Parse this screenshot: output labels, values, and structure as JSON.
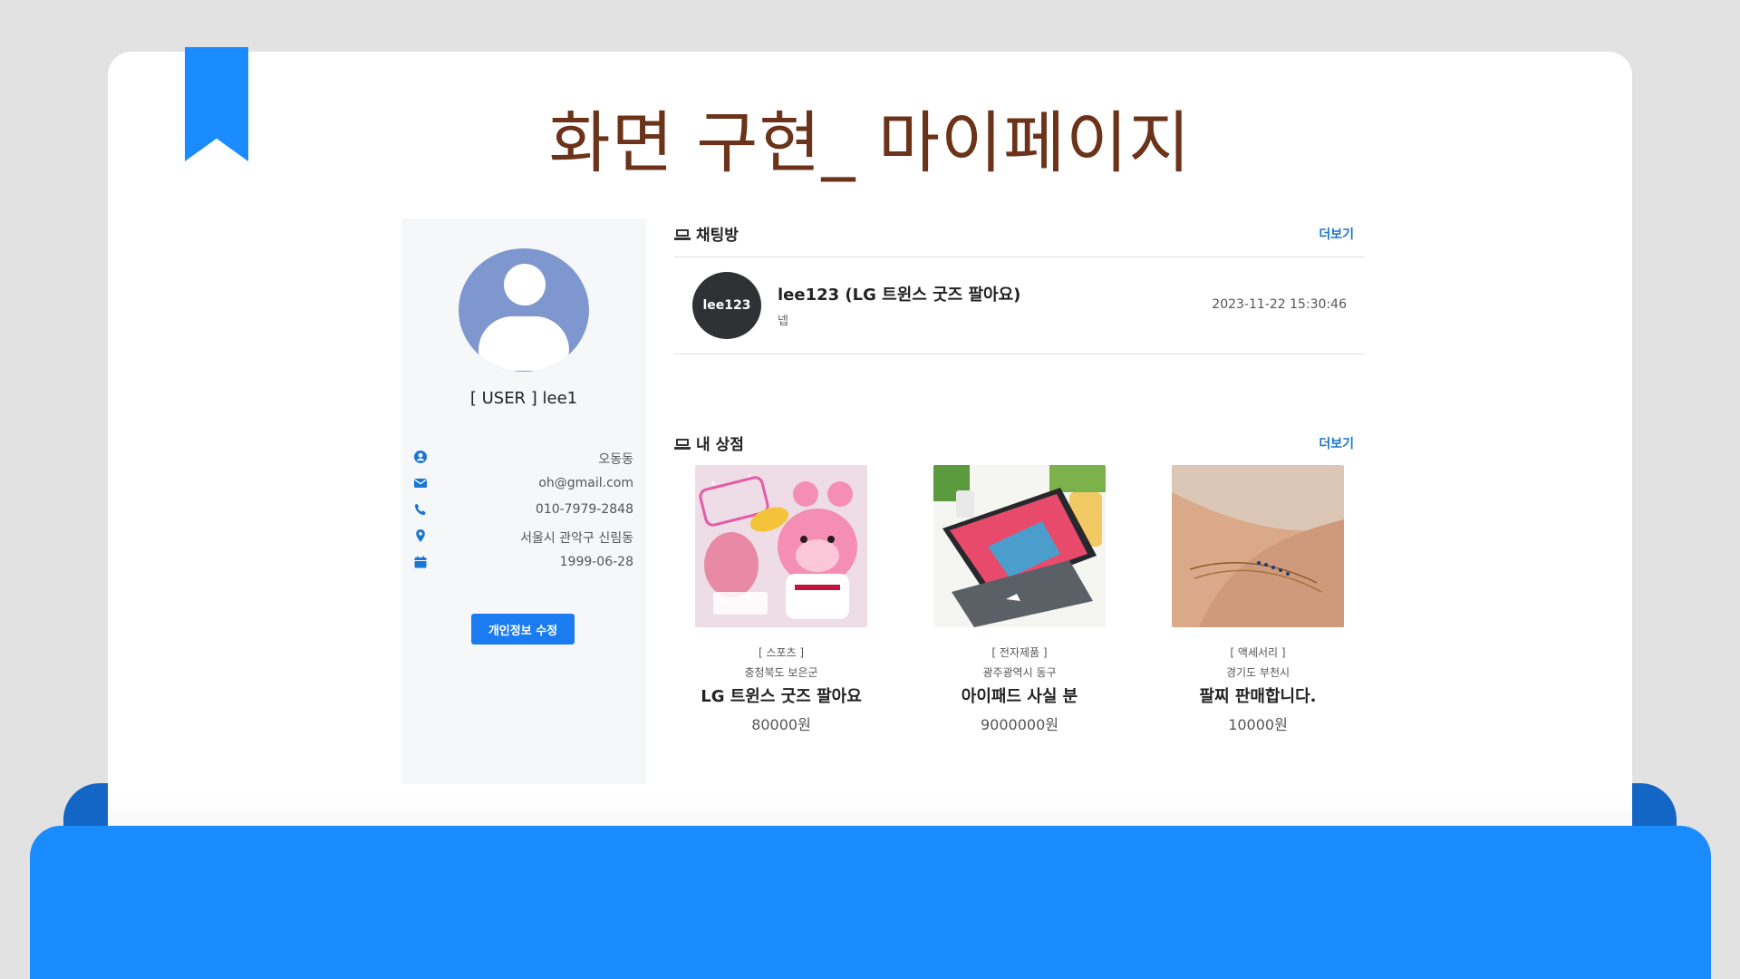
{
  "slide": {
    "title": "화면 구현_ 마이페이지"
  },
  "profile": {
    "username": "[ USER ] lee1",
    "details": [
      {
        "icon": "user-circle-icon",
        "value": "오동동"
      },
      {
        "icon": "envelope-icon",
        "value": "oh@gmail.com"
      },
      {
        "icon": "phone-icon",
        "value": "010-7979-2848"
      },
      {
        "icon": "map-pin-icon",
        "value": "서울시 관악구 신림동"
      },
      {
        "icon": "calendar-icon",
        "value": "1999-06-28"
      }
    ],
    "edit_button": "개인정보 수정"
  },
  "chat_section": {
    "title": "채팅방",
    "more": "더보기",
    "rooms": [
      {
        "avatar_text": "lee123",
        "title": "lee123 (LG 트윈스 굿즈 팔아요)",
        "last_message": "넵",
        "timestamp": "2023-11-22 15:30:46"
      }
    ]
  },
  "shop_section": {
    "title": "내 상점",
    "more": "더보기",
    "products": [
      {
        "category": "[ 스포츠 ]",
        "location": "충청북도 보은군",
        "name": "LG 트윈스 굿즈 팔아요",
        "price": "80000원"
      },
      {
        "category": "[ 전자제품 ]",
        "location": "광주광역시 동구",
        "name": "아이패드 사실 분",
        "price": "9000000원"
      },
      {
        "category": "[ 액세서리 ]",
        "location": "경기도 부천시",
        "name": "팔찌 판매합니다.",
        "price": "10000원"
      }
    ]
  },
  "colors": {
    "accent": "#1a8cff",
    "title_brown": "#6b3319",
    "link_blue": "#1a76d2"
  }
}
